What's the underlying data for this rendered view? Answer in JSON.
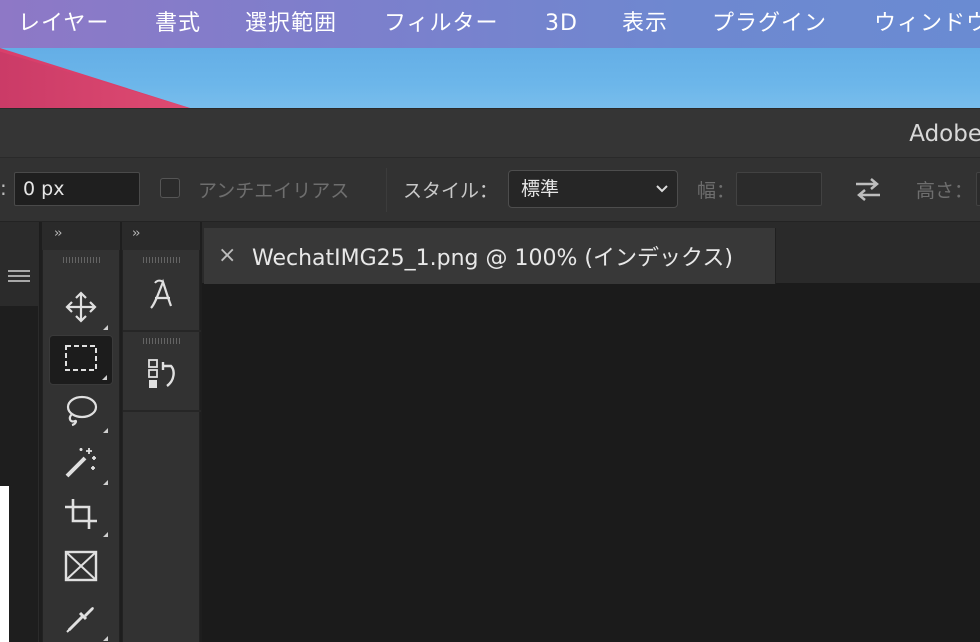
{
  "menubar": {
    "items": [
      "レイヤー",
      "書式",
      "選択範囲",
      "フィルター",
      "3D",
      "表示",
      "プラグイン",
      "ウィンドウ"
    ]
  },
  "titlebar": {
    "app_title": "Adobe"
  },
  "options": {
    "colon": ":",
    "feather_value": "0 px",
    "antialias_label": "アンチエイリアス",
    "style_label": "スタイル：",
    "style_value": "標準",
    "width_label": "幅：",
    "height_label": "高さ：",
    "width_value": "",
    "height_value": ""
  },
  "panels": {
    "collapse_glyph": "››"
  },
  "document": {
    "close_glyph": "×",
    "tab_title": "WechatIMG25_1.png @ 100% (インデックス)"
  },
  "colors": {
    "menubar": "#7d7fcc",
    "ui_dark": "#323232",
    "canvas": "#1b1b1b",
    "accent_pink": "#d93f6b",
    "wallpaper_blue": "#6cb6ea"
  },
  "tools": [
    "move-tool",
    "rectangular-marquee-tool",
    "lasso-tool",
    "magic-wand-tool",
    "crop-tool",
    "frame-tool",
    "eyedropper-tool"
  ],
  "tools2": [
    "character-panel",
    "history-panel"
  ]
}
